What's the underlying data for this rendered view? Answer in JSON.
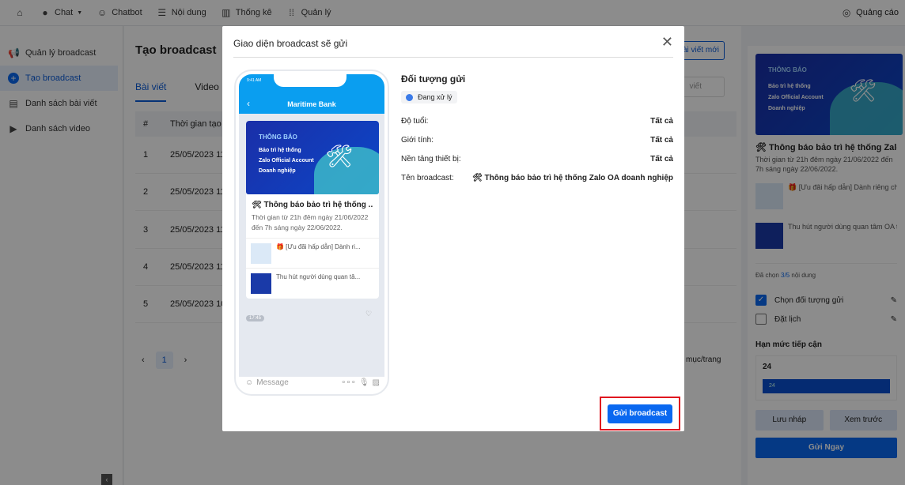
{
  "topbar": {
    "items": [
      {
        "icon": "home-icon",
        "label": ""
      },
      {
        "icon": "chat-icon",
        "label": "Chat"
      },
      {
        "icon": "chatbot-icon",
        "label": "Chatbot"
      },
      {
        "icon": "list-icon",
        "label": "Nội dung"
      },
      {
        "icon": "bar-chart-icon",
        "label": "Thống kê"
      },
      {
        "icon": "grid-icon",
        "label": "Quản lý"
      }
    ],
    "ads": "Quảng cáo"
  },
  "sidebar": {
    "items": [
      {
        "label": "Quản lý broadcast",
        "icon": "megaphone-icon"
      },
      {
        "label": "Tạo broadcast",
        "icon": "plus-circle-icon",
        "active": true
      },
      {
        "label": "Danh sách bài viết",
        "icon": "document-icon"
      },
      {
        "label": "Danh sách video",
        "icon": "video-icon"
      }
    ]
  },
  "main": {
    "title": "Tạo broadcast",
    "tabs": [
      "Bài viết",
      "Video"
    ],
    "new_button": "ài viết mới",
    "search_placeholder": "viết",
    "columns": [
      "#",
      "Thời gian tạo"
    ],
    "rows": [
      [
        "1",
        "25/05/2023 11"
      ],
      [
        "2",
        "25/05/2023 11"
      ],
      [
        "3",
        "25/05/2023 11"
      ],
      [
        "4",
        "25/05/2023 11"
      ],
      [
        "5",
        "25/05/2023 10"
      ]
    ],
    "page": "1",
    "per_page": "mục/trang"
  },
  "banner": {
    "title": "THÔNG BÁO",
    "lines": [
      "Bảo trì hệ thống",
      "Zalo Official Account",
      "Doanh nghiệp"
    ]
  },
  "right": {
    "post_title": "🛠 Thông báo bảo trì hệ thống Zalo...",
    "post_desc": "Thời gian từ 21h đêm ngày 21/06/2022 đến 7h sáng ngày 22/06/2022.",
    "items": [
      "🎁 [Ưu đãi hấp dẫn] Dành riêng cho...",
      "Thu hút người dùng quan tâm OA th..."
    ],
    "selected_prefix": "Đã chọn ",
    "selected_count": "3/5",
    "selected_suffix": " nội dung",
    "checks": [
      {
        "label": "Chọn đối tượng gửi",
        "checked": true
      },
      {
        "label": "Đặt lịch",
        "checked": false
      }
    ],
    "reach_title": "Hạn mức tiếp cận",
    "reach_value": "24",
    "reach_bar": "24",
    "save_draft": "Lưu nháp",
    "preview": "Xem trước",
    "send_now": "Gửi Ngay"
  },
  "modal": {
    "title": "Giao diện broadcast sẽ gửi",
    "phone": {
      "time": "9:41 AM",
      "header": "Maritime Bank",
      "post_title": "🛠 Thông báo bảo trì hệ thống ...",
      "post_desc": "Thời gian từ 21h đêm ngày 21/06/2022 đến 7h sáng ngày 22/06/2022.",
      "items": [
        "🎁 [Ưu đãi hấp dẫn] Dành ri...",
        "Thu hút người dùng quan tâ..."
      ],
      "timestamp": "17:45",
      "message_placeholder": "Message"
    },
    "audience_title": "Đối tượng gửi",
    "status": "Đang xử lý",
    "fields": [
      {
        "label": "Độ tuổi:",
        "value": "Tất cả"
      },
      {
        "label": "Giới tính:",
        "value": "Tất cả"
      },
      {
        "label": "Nền tảng thiết bị:",
        "value": "Tất cả"
      },
      {
        "label": "Tên broadcast:",
        "value": "🛠 Thông báo bảo trì hệ thống Zalo OA doanh nghiệp"
      }
    ],
    "send_button": "Gửi broadcast"
  },
  "colors": {
    "accent": "#0a68f0",
    "highlight": "#e0141e"
  }
}
